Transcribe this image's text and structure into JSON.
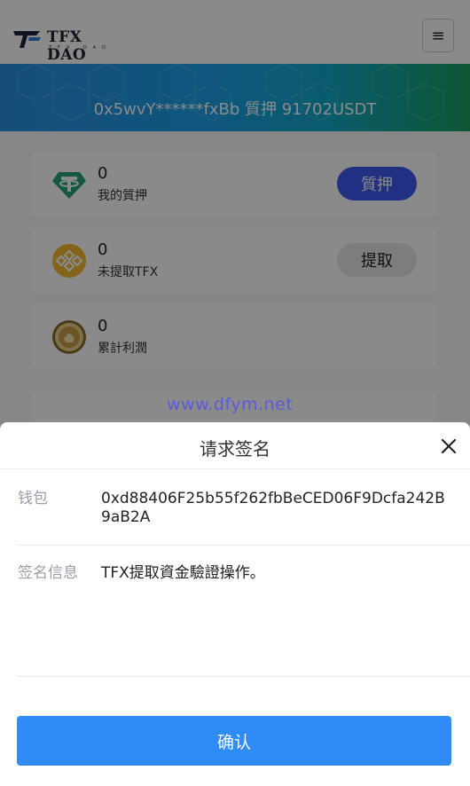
{
  "header": {
    "logo_title": "TFX DAO",
    "logo_subtitle": "TFX DAO",
    "menu_icon": "hamburger-icon"
  },
  "banner": {
    "text": "0x5wvY******fxBb 質押 91702USDT"
  },
  "cards": [
    {
      "value": "0",
      "label": "我的質押",
      "button": "質押",
      "icon": "tether-icon"
    },
    {
      "value": "0",
      "label": "未提取TFX",
      "button": "提取",
      "icon": "bnb-coin-icon"
    },
    {
      "value": "0",
      "label": "累計利潤",
      "icon": "gold-coin-icon"
    }
  ],
  "watermark": "www.dfym.net",
  "sheet": {
    "title": "请求签名",
    "wallet_label": "钱包",
    "wallet_value": "0xd88406F25b55f262fbBeCED06F9Dcfa242B9aB2A",
    "message_label": "签名信息",
    "message_value": "TFX提取資金驗證操作。",
    "confirm_label": "确认"
  },
  "colors": {
    "primary_button": "#3d5af1",
    "confirm_button": "#2f8bf5",
    "tether_green": "#26a17b",
    "bnb_gold": "#f3ba2f"
  }
}
